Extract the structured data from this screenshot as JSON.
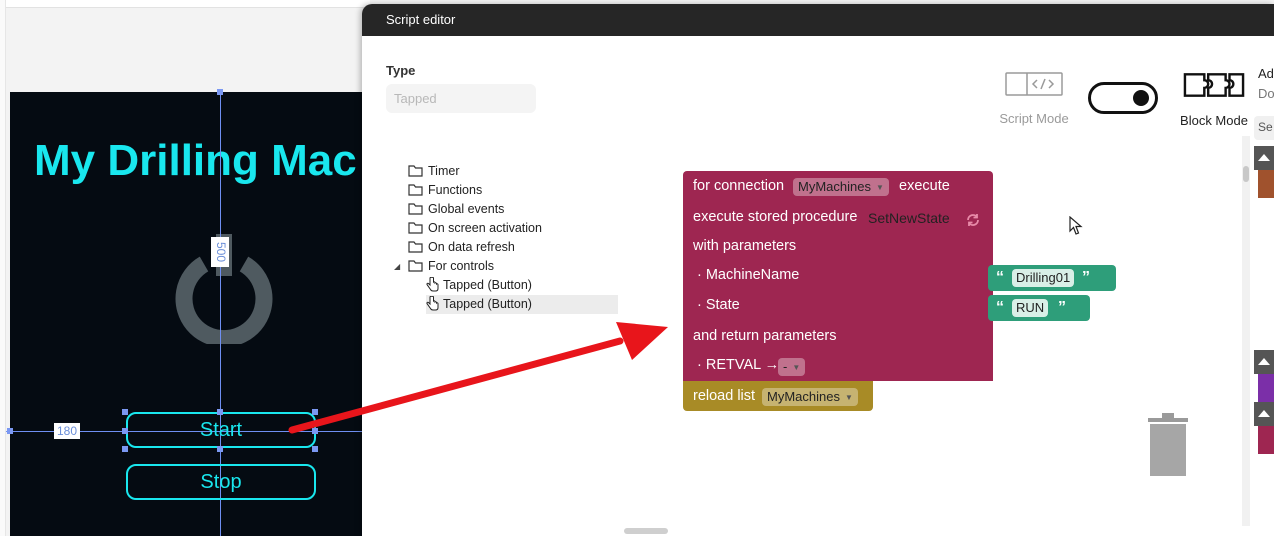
{
  "designer": {
    "app_title": "My Drilling Mac",
    "dim_vertical": "500",
    "dim_horizontal": "180",
    "start_label": "Start",
    "stop_label": "Stop",
    "accent_color": "#19e7ee"
  },
  "modal": {
    "title": "Script editor",
    "type_label": "Type",
    "type_value": "Tapped",
    "script_mode_label": "Script Mode",
    "block_mode_label": "Block Mode",
    "right_panel_text1": "Ad",
    "right_panel_text2": "Do",
    "right_panel_search": "Se"
  },
  "tree": {
    "items": [
      {
        "label": "Timer",
        "icon": "folder-icon"
      },
      {
        "label": "Functions",
        "icon": "folder-icon"
      },
      {
        "label": "Global events",
        "icon": "folder-icon"
      },
      {
        "label": "On screen activation",
        "icon": "folder-icon"
      },
      {
        "label": "On data refresh",
        "icon": "folder-icon"
      },
      {
        "label": "For controls",
        "icon": "folder-icon",
        "expanded": true
      },
      {
        "label": "Tapped (Button)",
        "icon": "hand-pointer-icon"
      },
      {
        "label": "Tapped (Button)",
        "icon": "hand-pointer-icon",
        "selected": true
      }
    ]
  },
  "blocks": {
    "for_connection": "for connection",
    "connection_value": "MyMachines",
    "execute": "execute",
    "execute_stored_procedure": "execute stored procedure",
    "procedure_name": "SetNewState",
    "with_parameters": "with parameters",
    "param1": "· MachineName",
    "param2": "· State",
    "and_return": "and return parameters",
    "retval": "· RETVAL →",
    "retval_value": "-",
    "reload_list": "reload list",
    "reload_value": "MyMachines",
    "string1": "Drilling01",
    "string2": "RUN",
    "colors": {
      "procedure_block": "#9e2651",
      "reload_block": "#a88b26",
      "string_block": "#2e9e7a",
      "annotation_arrow": "#e8151b"
    }
  }
}
